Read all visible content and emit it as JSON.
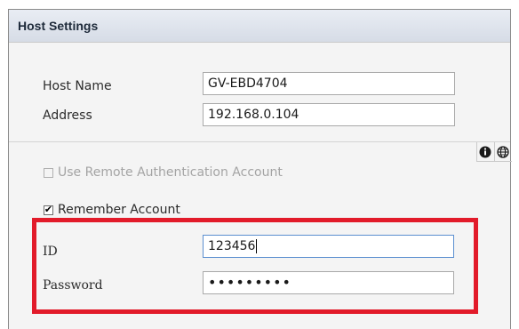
{
  "panel": {
    "title": "Host Settings"
  },
  "host": {
    "host_name_label": "Host Name",
    "host_name_value": "GV-EBD4704",
    "address_label": "Address",
    "address_value": "192.168.0.104"
  },
  "auth": {
    "remote_auth_label": "Use Remote Authentication Account",
    "remote_auth_checked": false,
    "remote_auth_enabled": false,
    "remember_label": "Remember Account",
    "remember_checked": true,
    "remember_mark": "✔",
    "id_label": "ID",
    "id_value": "123456",
    "password_label": "Password",
    "password_value": "•••••••••"
  },
  "icons": [
    "info-icon",
    "globe-icon"
  ],
  "colors": {
    "highlight": "#e21b2a",
    "header_bg": "#dde2ea",
    "panel_bg": "#f4f4f4"
  }
}
